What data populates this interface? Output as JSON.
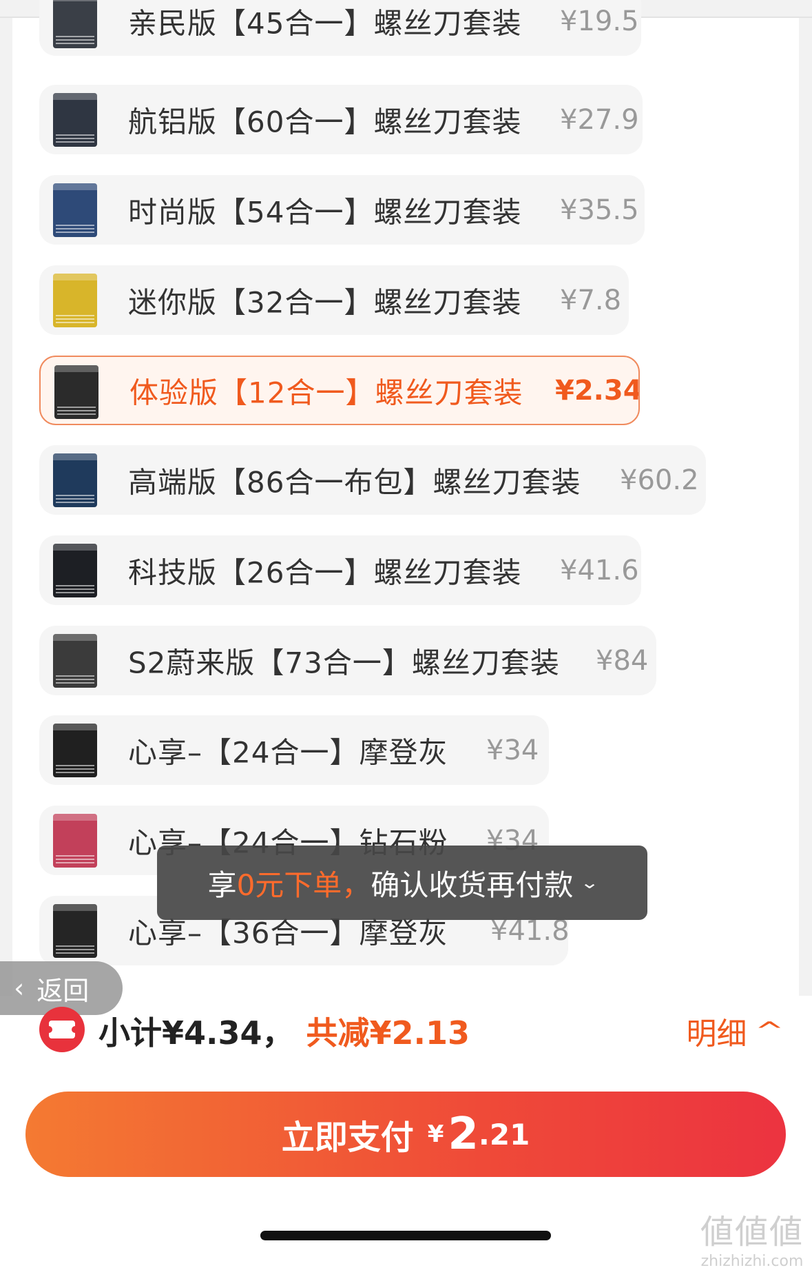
{
  "options": [
    {
      "label": "亲民版【45合一】螺丝刀套装",
      "price": "¥19.5",
      "thumb_color": "#3a3f47",
      "selected": false
    },
    {
      "label": "航铝版【60合一】螺丝刀套装",
      "price": "¥27.9",
      "thumb_color": "#2f3642",
      "selected": false
    },
    {
      "label": "时尚版【54合一】螺丝刀套装",
      "price": "¥35.5",
      "thumb_color": "#2e4a78",
      "selected": false
    },
    {
      "label": "迷你版【32合一】螺丝刀套装",
      "price": "¥7.8",
      "thumb_color": "#d8b52a",
      "selected": false
    },
    {
      "label": "体验版【12合一】螺丝刀套装",
      "price": "¥2.34",
      "thumb_color": "#2b2b2b",
      "selected": true
    },
    {
      "label": "高端版【86合一布包】螺丝刀套装",
      "price": "¥60.2",
      "thumb_color": "#1f3a5c",
      "selected": false
    },
    {
      "label": "科技版【26合一】螺丝刀套装",
      "price": "¥41.6",
      "thumb_color": "#1d1f24",
      "selected": false
    },
    {
      "label": "S2蔚来版【73合一】螺丝刀套装",
      "price": "¥84",
      "thumb_color": "#3b3b3b",
      "selected": false
    },
    {
      "label": "心享–【24合一】摩登灰",
      "price": "¥34",
      "thumb_color": "#202020",
      "selected": false
    },
    {
      "label": "心享–【24合一】钻石粉",
      "price": "¥34",
      "thumb_color": "#c2405a",
      "selected": false
    },
    {
      "label": "心享–【36合一】摩登灰",
      "price": "¥41.8",
      "thumb_color": "#252525",
      "selected": false
    }
  ],
  "toast": {
    "prefix": "享",
    "highlight": "0元下单，",
    "rest": "确认收货再付款",
    "chevron": "⌄"
  },
  "back": {
    "arrow": "‹",
    "label": "返回"
  },
  "summary": {
    "subtotal": "小计¥4.34",
    "separator": "，",
    "saved": "共减¥2.13",
    "detail_label": "明细",
    "detail_chevron": "^"
  },
  "pay": {
    "label": "立即支付",
    "currency": "¥",
    "amount_int": "2",
    "amount_dec": ".21"
  },
  "watermark": {
    "glyphs": "値値値",
    "site": "zhizhizhi.com"
  },
  "colors": {
    "accent": "#f05a1e",
    "pay_gradient_start": "#f47a32",
    "pay_gradient_end": "#ec3340"
  }
}
